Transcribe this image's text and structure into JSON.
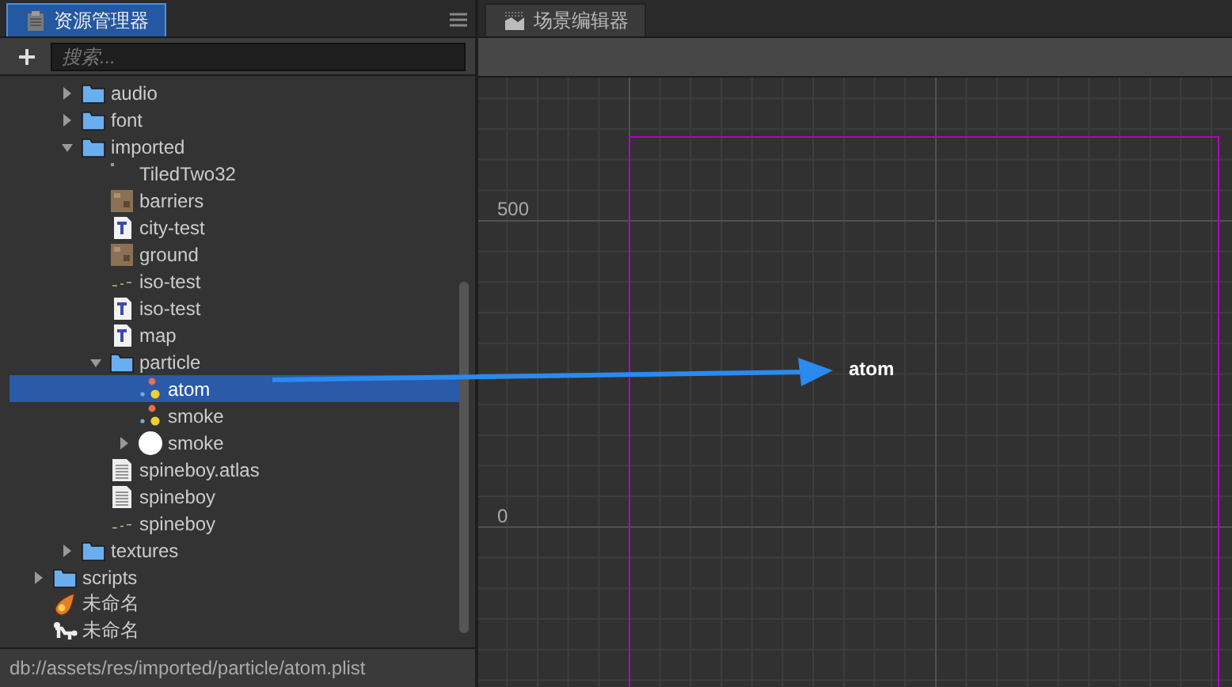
{
  "assets_panel": {
    "tab": {
      "label": "资源管理器",
      "selected": true
    },
    "search": {
      "placeholder": "搜索..."
    },
    "tree": [
      {
        "children": [
          {
            "label": "audio",
            "kind": "folder",
            "expanded": false,
            "selected": false
          },
          {
            "label": "font",
            "kind": "folder",
            "expanded": false,
            "selected": false
          },
          {
            "label": "imported",
            "kind": "folder",
            "expanded": true,
            "selected": false,
            "children": [
              {
                "label": "TiledTwo32",
                "kind": "blank",
                "selected": false
              },
              {
                "label": "barriers",
                "kind": "texture",
                "selected": false
              },
              {
                "label": "city-test",
                "kind": "tiled",
                "selected": false
              },
              {
                "label": "ground",
                "kind": "texture",
                "selected": false
              },
              {
                "label": "iso-test",
                "kind": "sprite",
                "selected": false
              },
              {
                "label": "iso-test",
                "kind": "tiled",
                "selected": false
              },
              {
                "label": "map",
                "kind": "tiled",
                "selected": false
              },
              {
                "label": "particle",
                "kind": "folder",
                "expanded": true,
                "selected": false,
                "children": [
                  {
                    "label": "atom",
                    "kind": "particle",
                    "selected": true
                  },
                  {
                    "label": "smoke",
                    "kind": "particle",
                    "selected": false
                  },
                  {
                    "label": "smoke",
                    "kind": "circle",
                    "expanded": false,
                    "selected": false
                  }
                ]
              },
              {
                "label": "spineboy.atlas",
                "kind": "doc",
                "selected": false
              },
              {
                "label": "spineboy",
                "kind": "doc",
                "selected": false
              },
              {
                "label": "spineboy",
                "kind": "sprite",
                "selected": false
              }
            ]
          },
          {
            "label": "textures",
            "kind": "folder",
            "expanded": false,
            "selected": false
          }
        ]
      },
      {
        "label": "scripts",
        "kind": "folder",
        "expanded": false,
        "selected": false
      },
      {
        "label": "未命名",
        "kind": "fire",
        "selected": false
      },
      {
        "label": "未命名",
        "kind": "skeleton",
        "selected": false
      }
    ],
    "status": "db://assets/res/imported/particle/atom.plist"
  },
  "scene_panel": {
    "tab": {
      "label": "场景编辑器",
      "selected": false
    },
    "y_labels": [
      "500",
      "0"
    ],
    "node_label": "atom"
  }
}
